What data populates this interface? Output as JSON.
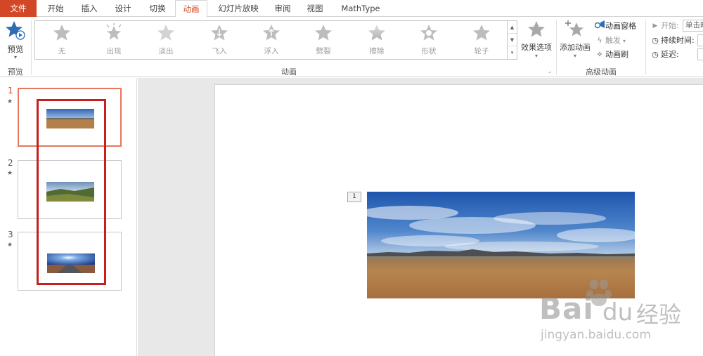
{
  "tabs": [
    {
      "label": "文件"
    },
    {
      "label": "开始"
    },
    {
      "label": "插入"
    },
    {
      "label": "设计"
    },
    {
      "label": "切换"
    },
    {
      "label": "动画"
    },
    {
      "label": "幻灯片放映"
    },
    {
      "label": "审阅"
    },
    {
      "label": "视图"
    },
    {
      "label": "MathType"
    }
  ],
  "ribbon": {
    "preview": {
      "label": "预览",
      "group": "预览"
    },
    "animation_gallery": {
      "items": [
        {
          "label": "无"
        },
        {
          "label": "出现"
        },
        {
          "label": "淡出"
        },
        {
          "label": "飞入"
        },
        {
          "label": "浮入"
        },
        {
          "label": "劈裂"
        },
        {
          "label": "擦除"
        },
        {
          "label": "形状"
        },
        {
          "label": "轮子"
        }
      ],
      "group": "动画"
    },
    "effect_options": {
      "label": "效果选项"
    },
    "advanced": {
      "add_animation": "添加动画",
      "animation_pane": "动画窗格",
      "trigger": "触发",
      "animation_painter": "动画刷",
      "group": "高级动画"
    },
    "timing": {
      "start_label": "开始:",
      "start_value": "单击时",
      "duration_label": "持续时间:",
      "delay_label": "延迟:"
    }
  },
  "thumbnails": [
    {
      "number": "1",
      "star": "★"
    },
    {
      "number": "2",
      "star": "★"
    },
    {
      "number": "3",
      "star": "★"
    }
  ],
  "slide": {
    "animation_tag": "1"
  },
  "watermark": {
    "brand": "Bai",
    "brand_cn": "经验",
    "url": "jingyan.baidu.com"
  },
  "colors": {
    "accent": "#d24726",
    "highlight": "#c81e1e"
  }
}
